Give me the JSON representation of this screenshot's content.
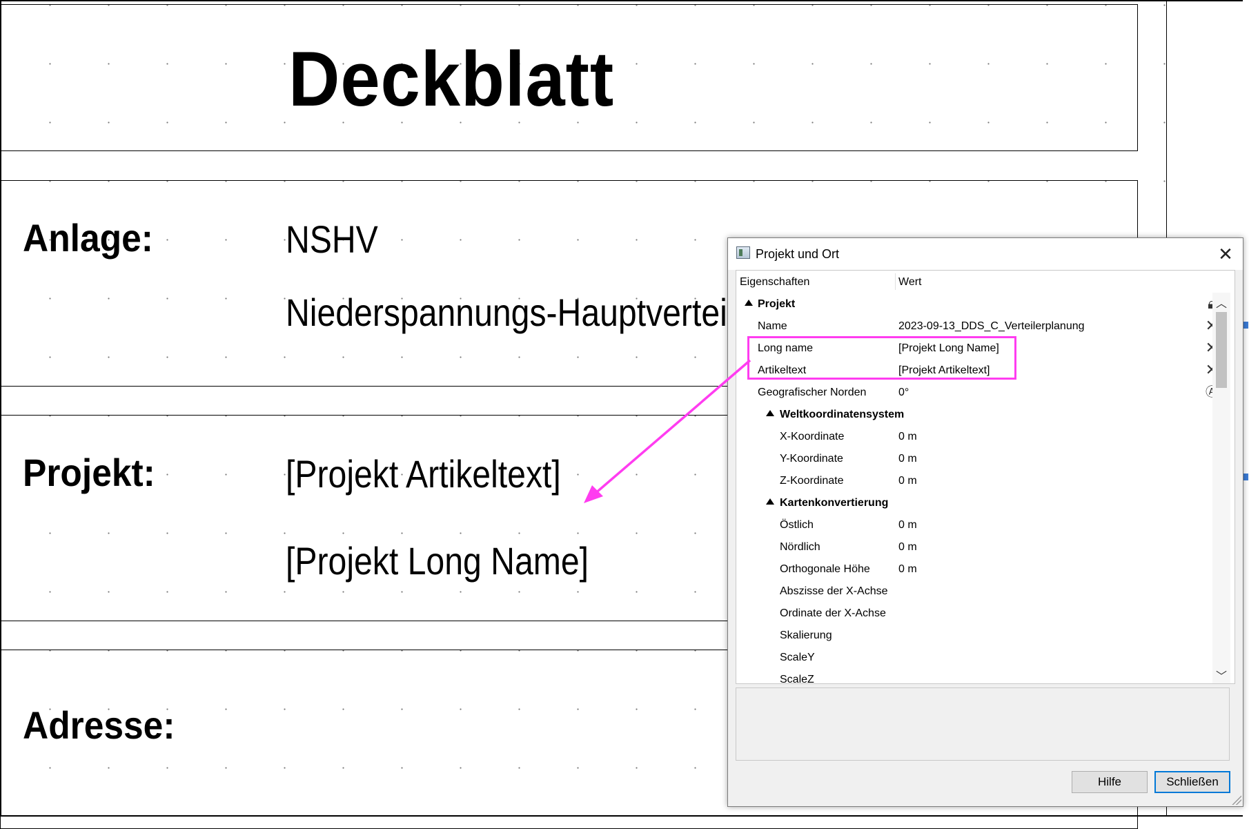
{
  "sheet": {
    "title": "Deckblatt",
    "rows": [
      {
        "label": "Anlage:",
        "values": [
          "NSHV",
          "Niederspannungs-Hauptverteil"
        ]
      },
      {
        "label": "Projekt:",
        "values": [
          "[Projekt Artikeltext]",
          "[Projekt Long Name]"
        ]
      },
      {
        "label": "Adresse:",
        "values": []
      }
    ]
  },
  "dialog": {
    "title": "Projekt und Ort",
    "close_icon": "close-icon",
    "columns": {
      "property": "Eigenschaften",
      "value": "Wert"
    },
    "rows": [
      {
        "name": "Projekt",
        "value": "",
        "group": true,
        "icon": "lock-icon"
      },
      {
        "name": "Name",
        "value": "2023-09-13_DDS_C_Verteilerplanung",
        "icon": "clear-icon"
      },
      {
        "name": "Long name",
        "value": "[Projekt Long Name]",
        "icon": "clear-icon"
      },
      {
        "name": "Artikeltext",
        "value": "[Projekt Artikeltext]",
        "icon": "clear-icon"
      },
      {
        "name": "Geografischer Norden",
        "value": "0°",
        "icon": "compass-icon"
      },
      {
        "name": "Weltkoordinatensystem",
        "value": "",
        "group": true
      },
      {
        "name": "X-Koordinate",
        "value": "0 m"
      },
      {
        "name": "Y-Koordinate",
        "value": "0 m"
      },
      {
        "name": "Z-Koordinate",
        "value": "0 m"
      },
      {
        "name": "Kartenkonvertierung",
        "value": "",
        "group": true
      },
      {
        "name": "Östlich",
        "value": "0 m"
      },
      {
        "name": "Nördlich",
        "value": "0 m"
      },
      {
        "name": "Orthogonale Höhe",
        "value": "0 m"
      },
      {
        "name": "Abszisse der X-Achse",
        "value": ""
      },
      {
        "name": "Ordinate der X-Achse",
        "value": ""
      },
      {
        "name": "Skalierung",
        "value": ""
      },
      {
        "name": "ScaleY",
        "value": ""
      },
      {
        "name": "ScaleZ",
        "value": ""
      }
    ],
    "buttons": {
      "help": "Hilfe",
      "close": "Schließen"
    }
  },
  "annotation": {
    "highlight_color": "#ff3cf0"
  }
}
